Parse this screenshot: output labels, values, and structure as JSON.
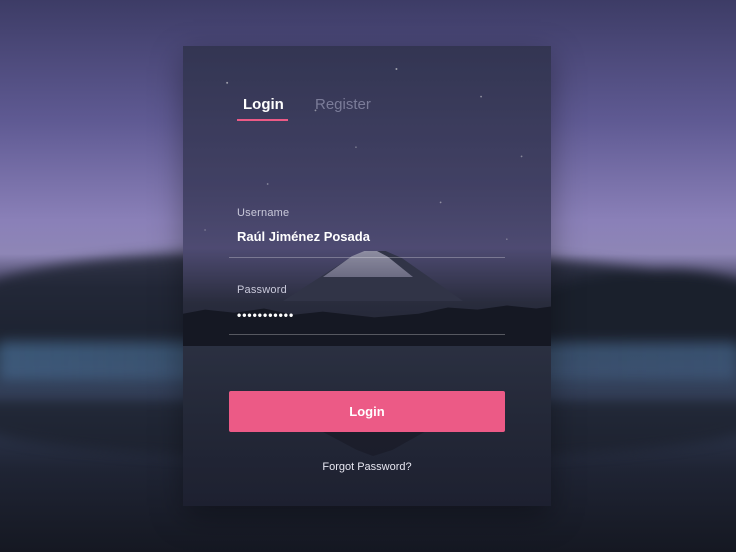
{
  "tabs": {
    "login_label": "Login",
    "register_label": "Register"
  },
  "form": {
    "username_label": "Username",
    "username_value": "Raúl Jiménez Posada",
    "password_label": "Password",
    "password_value": "•••••••••••",
    "login_button": "Login",
    "forgot_password": "Forgot Password?"
  },
  "colors": {
    "accent": "#ec5a86",
    "tab_inactive": "#7b7c99",
    "text_light": "#ffffff"
  }
}
